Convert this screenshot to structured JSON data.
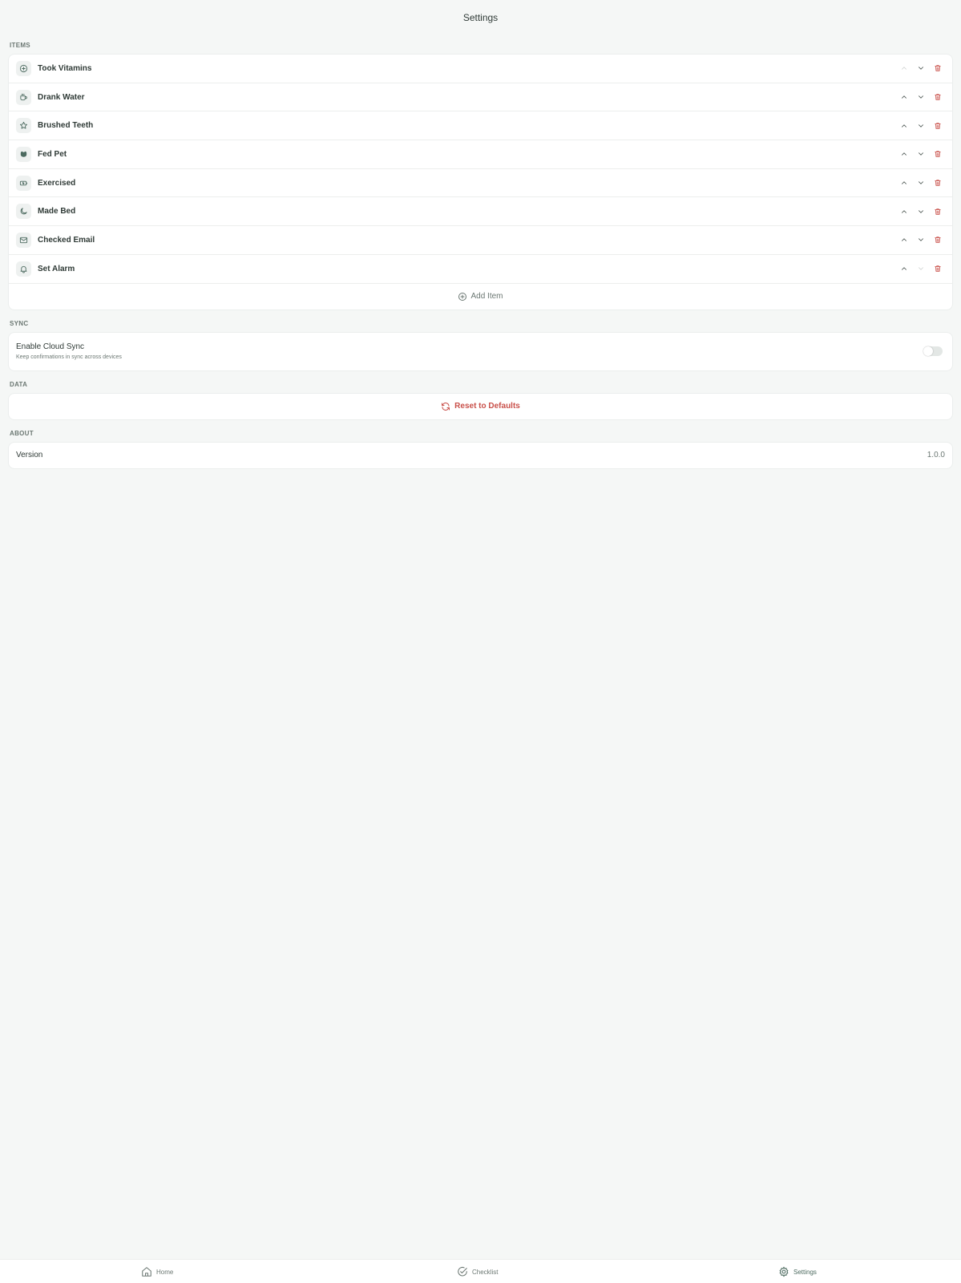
{
  "header": {
    "title": "Settings"
  },
  "sections": {
    "items": "ITEMS",
    "sync": "SYNC",
    "data": "DATA",
    "about": "ABOUT"
  },
  "items": [
    {
      "label": "Took Vitamins",
      "icon": "plus-circle-icon",
      "up_enabled": false,
      "down_enabled": true
    },
    {
      "label": "Drank Water",
      "icon": "cup-icon",
      "up_enabled": true,
      "down_enabled": true
    },
    {
      "label": "Brushed Teeth",
      "icon": "star-icon",
      "up_enabled": true,
      "down_enabled": true
    },
    {
      "label": "Fed Pet",
      "icon": "pet-icon",
      "up_enabled": true,
      "down_enabled": true
    },
    {
      "label": "Exercised",
      "icon": "battery-icon",
      "up_enabled": true,
      "down_enabled": true
    },
    {
      "label": "Made Bed",
      "icon": "moon-icon",
      "up_enabled": true,
      "down_enabled": true
    },
    {
      "label": "Checked Email",
      "icon": "mail-icon",
      "up_enabled": true,
      "down_enabled": true
    },
    {
      "label": "Set Alarm",
      "icon": "bell-icon",
      "up_enabled": true,
      "down_enabled": false
    }
  ],
  "add_item": {
    "label": "Add Item"
  },
  "sync": {
    "title": "Enable Cloud Sync",
    "description": "Keep confirmations in sync across devices",
    "enabled": false
  },
  "data": {
    "reset_label": "Reset to Defaults"
  },
  "about": {
    "version_label": "Version",
    "version_value": "1.0.0"
  },
  "tabs": [
    {
      "label": "Home",
      "icon": "home-icon",
      "active": false
    },
    {
      "label": "Checklist",
      "icon": "check-circle-icon",
      "active": false
    },
    {
      "label": "Settings",
      "icon": "gear-icon",
      "active": true
    }
  ],
  "colors": {
    "background": "#f5f7f6",
    "accent": "#4d6b60",
    "danger": "#c9504a",
    "text": "#2f3a36",
    "muted": "#6b7772"
  }
}
